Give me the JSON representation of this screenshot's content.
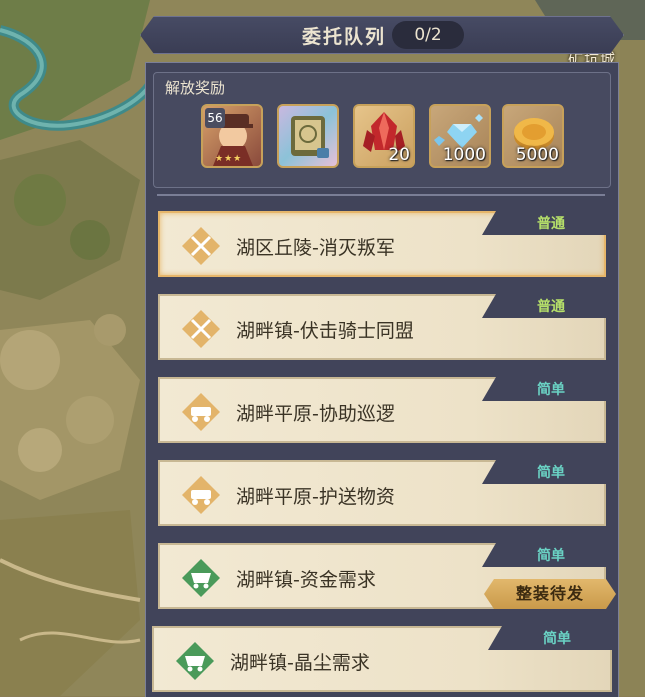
{
  "map": {
    "city_label": "矿坑城"
  },
  "header": {
    "title": "委托队列",
    "count": "0/2"
  },
  "rewards": {
    "title": "解放奖励",
    "items": [
      {
        "icon": "hero-portrait-icon",
        "level": "56",
        "stars": "★★★",
        "count": ""
      },
      {
        "icon": "scroll-icon",
        "count": ""
      },
      {
        "icon": "red-crystal-icon",
        "count": "20"
      },
      {
        "icon": "blue-diamond-icon",
        "count": "1000"
      },
      {
        "icon": "gold-coin-icon",
        "count": "5000"
      }
    ]
  },
  "missions": [
    {
      "name": "湖区丘陵-消灭叛军",
      "difficulty": "普通",
      "icon": "crossed-swords-icon"
    },
    {
      "name": "湖畔镇-伏击骑士同盟",
      "difficulty": "普通",
      "icon": "crossed-swords-icon"
    },
    {
      "name": "湖畔平原-协助巡逻",
      "difficulty": "简单",
      "icon": "cart-icon"
    },
    {
      "name": "湖畔平原-护送物资",
      "difficulty": "简单",
      "icon": "cart-icon"
    },
    {
      "name": "湖畔镇-资金需求",
      "difficulty": "简单",
      "icon": "mine-cart-icon"
    },
    {
      "name": "湖畔镇-晶尘需求",
      "difficulty": "简单",
      "icon": "mine-cart-icon"
    }
  ],
  "dispatch_label": "整装待发",
  "colors": {
    "panel": "#41445a",
    "card": "#f2e9d3",
    "normal": "#b6e06a",
    "simple": "#6ad2c4",
    "accent": "#e2b86c"
  }
}
